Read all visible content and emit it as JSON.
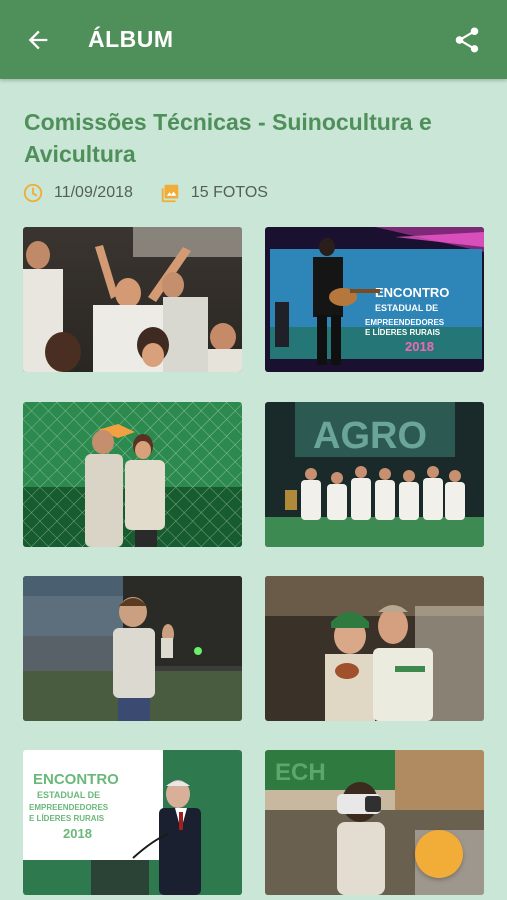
{
  "appbar": {
    "title": "ÁLBUM",
    "back_icon": "arrow-left-icon",
    "share_icon": "share-icon",
    "color": "#4f8f5a"
  },
  "album": {
    "title": "Comissões Técnicas - Suinocultura e Avicultura",
    "date": "11/09/2018",
    "photo_count": "15 FOTOS",
    "date_icon": "clock-icon",
    "photos_icon": "photo-library-icon",
    "accent": "#f2ad38"
  },
  "photos": [
    {
      "name": "photo-crowd-celebrating"
    },
    {
      "name": "photo-guitarist-on-stage"
    },
    {
      "name": "photo-couple-green-net"
    },
    {
      "name": "photo-group-agro-sign"
    },
    {
      "name": "photo-boy-thumbs-up"
    },
    {
      "name": "photo-couple-with-cap"
    },
    {
      "name": "photo-speaker-podium"
    },
    {
      "name": "photo-child-vr-headset"
    }
  ],
  "fab_icon": "fab-button",
  "background": "#c9e6d6"
}
